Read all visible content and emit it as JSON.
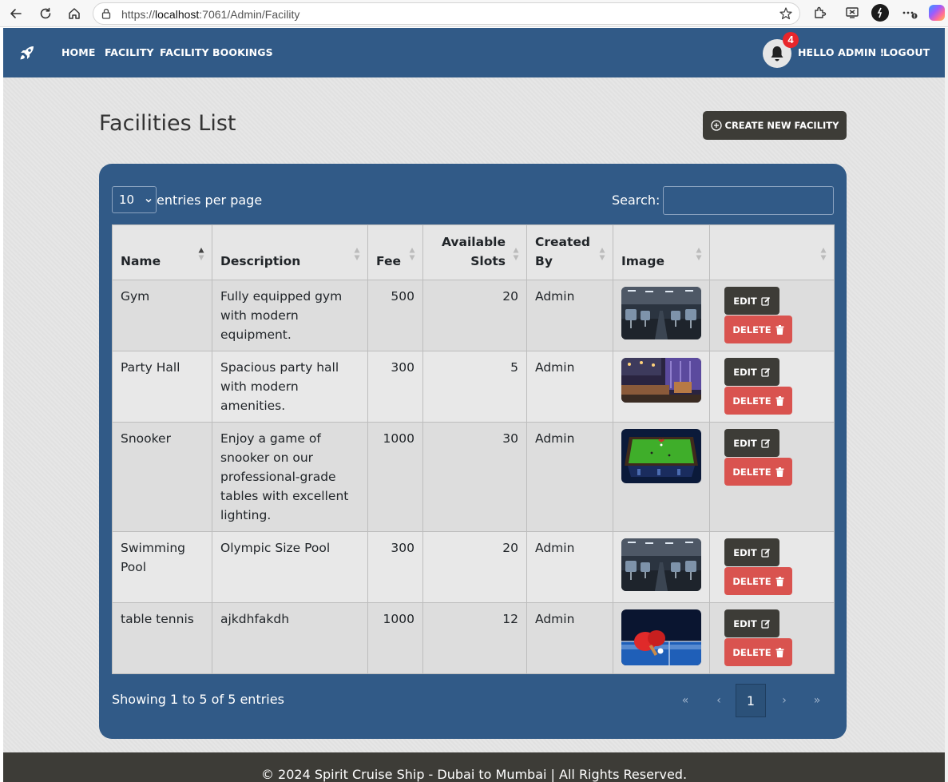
{
  "browser": {
    "url_prefix": "https://",
    "url_host": "localhost",
    "url_rest": ":7061/Admin/Facility"
  },
  "navbar": {
    "links": [
      "HOME",
      "FACILITY",
      "FACILITY BOOKINGS"
    ],
    "notification_count": "4",
    "greeting": "HELLO ADMIN !",
    "logout": "LOGOUT"
  },
  "page": {
    "title": "Facilities List",
    "create_button": "CREATE NEW FACILITY"
  },
  "table_controls": {
    "entries_value": "10",
    "entries_label": "entries per page",
    "search_label": "Search:",
    "search_value": ""
  },
  "table": {
    "columns": [
      "Name",
      "Description",
      "Fee",
      "Available Slots",
      "Created By",
      "Image",
      ""
    ],
    "rows": [
      {
        "name": "Gym",
        "description": "Fully equipped gym with modern equipment.",
        "fee": "500",
        "slots": "20",
        "created_by": "Admin",
        "image": "gym-photo",
        "edit": "EDIT",
        "delete": "DELETE"
      },
      {
        "name": "Party Hall",
        "description": "Spacious party hall with modern amenities.",
        "fee": "300",
        "slots": "5",
        "created_by": "Admin",
        "image": "party-hall-photo",
        "edit": "EDIT",
        "delete": "DELETE"
      },
      {
        "name": "Snooker",
        "description": "Enjoy a game of snooker on our professional-grade tables with excellent lighting.",
        "fee": "1000",
        "slots": "30",
        "created_by": "Admin",
        "image": "snooker-table-photo",
        "edit": "EDIT",
        "delete": "DELETE"
      },
      {
        "name": "Swimming Pool",
        "description": "Olympic Size Pool",
        "fee": "300",
        "slots": "20",
        "created_by": "Admin",
        "image": "gym-photo",
        "edit": "EDIT",
        "delete": "DELETE"
      },
      {
        "name": "table tennis",
        "description": "ajkdhfakdh",
        "fee": "1000",
        "slots": "12",
        "created_by": "Admin",
        "image": "table-tennis-photo",
        "edit": "EDIT",
        "delete": "DELETE"
      }
    ]
  },
  "pagination": {
    "info": "Showing 1 to 5 of 5 entries",
    "first": "«",
    "prev": "‹",
    "current": "1",
    "next": "›",
    "last": "»"
  },
  "footer": {
    "text": "© 2024 Spirit Cruise Ship - Dubai to Mumbai | All Rights Reserved."
  },
  "colors": {
    "navbar": "#315a87",
    "dark_button": "#3d3c37",
    "delete_button": "#d9534f",
    "badge": "#e8262b"
  }
}
